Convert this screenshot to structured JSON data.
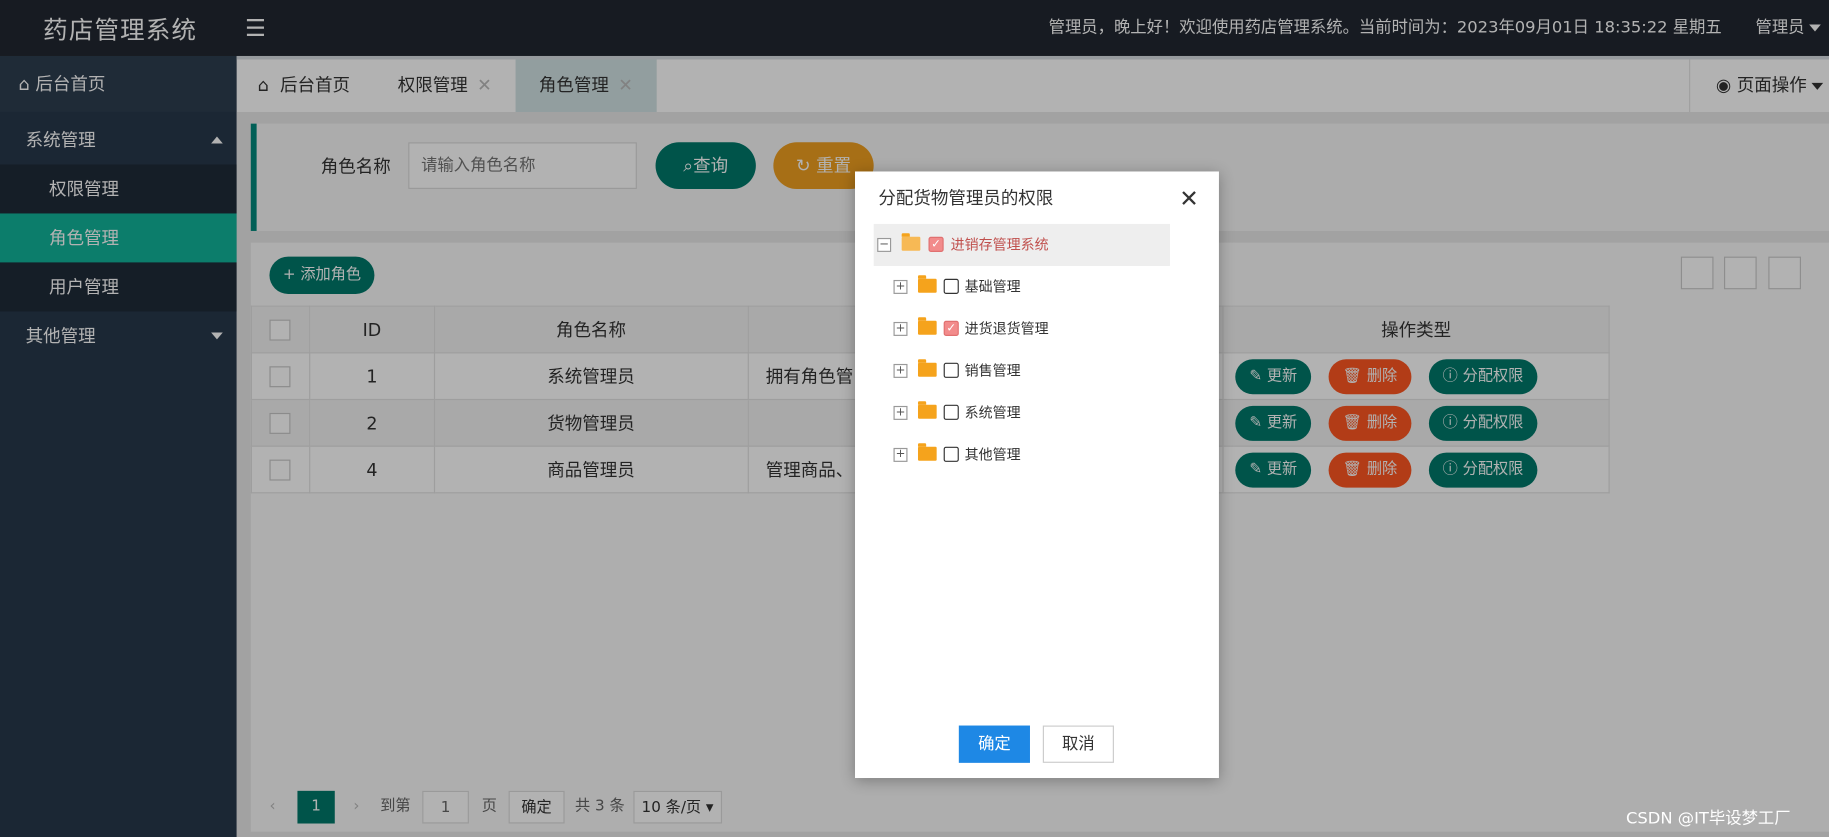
{
  "app": {
    "title": "药店管理系统",
    "welcome": "管理员，晚上好！欢迎使用药店管理系统。当前时间为：2023年09月01日 18:35:22 星期五",
    "user": "管理员"
  },
  "sidebar": {
    "home": "后台首页",
    "groups": [
      {
        "label": "系统管理",
        "items": [
          "权限管理",
          "角色管理",
          "用户管理"
        ]
      },
      {
        "label": "其他管理"
      }
    ]
  },
  "tabs": [
    {
      "label": "后台首页"
    },
    {
      "label": "权限管理",
      "close": "✕"
    },
    {
      "label": "角色管理",
      "close": "✕"
    }
  ],
  "page_ops": "页面操作",
  "search": {
    "label": "角色名称",
    "placeholder": "请输入角色名称",
    "query": "查询",
    "reset": "重置"
  },
  "toolbar": {
    "add": "添加角色"
  },
  "table": {
    "headers": [
      "ID",
      "角色名称",
      "操作类型"
    ],
    "rows": [
      {
        "id": "1",
        "name": "系统管理员",
        "desc": "拥有角色管"
      },
      {
        "id": "2",
        "name": "货物管理员",
        "desc": ""
      },
      {
        "id": "4",
        "name": "商品管理员",
        "desc": "管理商品、"
      }
    ],
    "actions": {
      "update": "更新",
      "delete": "删除",
      "assign": "分配权限"
    }
  },
  "pager": {
    "current": "1",
    "goto": "到第",
    "page_value": "1",
    "page_unit": "页",
    "confirm": "确定",
    "total": "共 3 条",
    "page_size": "10 条/页"
  },
  "dialog": {
    "title": "分配货物管理员的权限",
    "root": {
      "label": "进销存管理系统",
      "checked": true
    },
    "nodes": [
      {
        "label": "基础管理",
        "checked": false
      },
      {
        "label": "进货退货管理",
        "checked": true
      },
      {
        "label": "销售管理",
        "checked": false
      },
      {
        "label": "系统管理",
        "checked": false
      },
      {
        "label": "其他管理",
        "checked": false
      }
    ],
    "ok": "确定",
    "cancel": "取消"
  },
  "watermark": "CSDN @IT毕设梦工厂",
  "colors": {
    "topbar": "#212832",
    "sidebar": "#28394b",
    "accent_teal": "#00796b",
    "active_menu": "#12b39a",
    "reset_orange": "#f0a020",
    "danger": "#ff5722",
    "primary_blue": "#1e88e5"
  },
  "icons": [
    "menu-icon",
    "home-icon",
    "search-icon",
    "refresh-icon",
    "plus-icon",
    "edit-icon",
    "trash-icon",
    "info-icon",
    "grid-icon",
    "export-icon",
    "print-icon",
    "close-icon",
    "folder-icon",
    "folder-open-icon",
    "target-icon"
  ]
}
